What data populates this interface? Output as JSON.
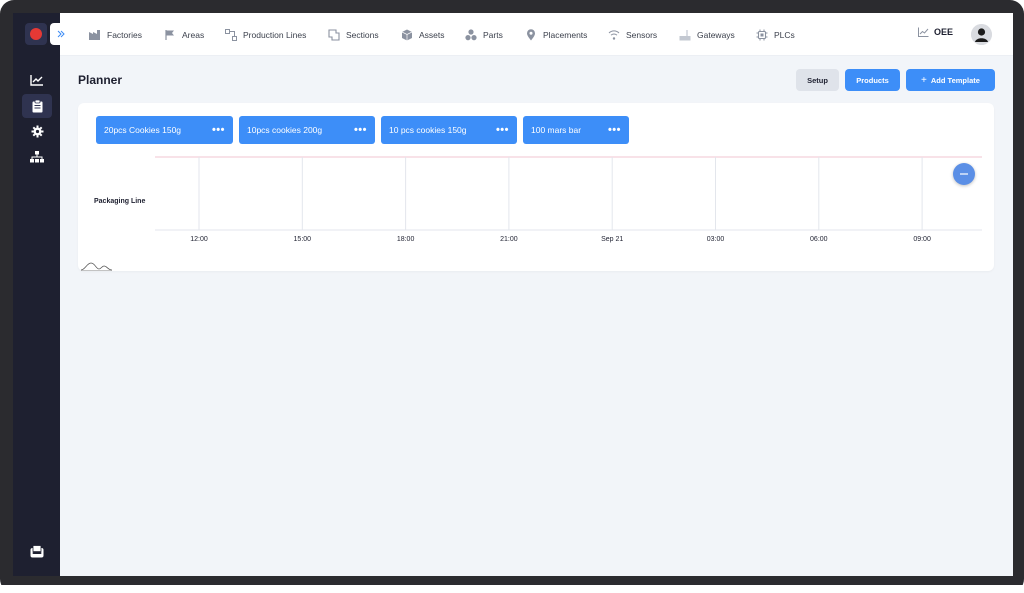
{
  "nav": {
    "items": [
      {
        "label": "Factories",
        "icon": "factory-icon"
      },
      {
        "label": "Areas",
        "icon": "flag-icon"
      },
      {
        "label": "Production Lines",
        "icon": "production-line-icon"
      },
      {
        "label": "Sections",
        "icon": "sections-icon"
      },
      {
        "label": "Assets",
        "icon": "cube-icon"
      },
      {
        "label": "Parts",
        "icon": "parts-icon"
      },
      {
        "label": "Placements",
        "icon": "pin-icon"
      },
      {
        "label": "Sensors",
        "icon": "wifi-icon"
      },
      {
        "label": "Gateways",
        "icon": "gateway-icon"
      },
      {
        "label": "PLCs",
        "icon": "chip-icon"
      }
    ],
    "oee_label": "OEE"
  },
  "sidebar": {
    "items": [
      {
        "name": "analytics",
        "icon": "chart-line-icon"
      },
      {
        "name": "planner",
        "icon": "clipboard-icon",
        "active": true
      },
      {
        "name": "settings",
        "icon": "gear-icon"
      },
      {
        "name": "hierarchy",
        "icon": "sitemap-icon"
      }
    ],
    "bottom_icon": "inbox-icon"
  },
  "page": {
    "title": "Planner",
    "setup_label": "Setup",
    "products_label": "Products",
    "add_template_label": "Add Template"
  },
  "templates": [
    {
      "label": "20pcs Cookies 150g"
    },
    {
      "label": "10pcs cookies 200g"
    },
    {
      "label": "10 pcs cookies 150g"
    },
    {
      "label": "100 mars bar"
    }
  ],
  "timeline": {
    "row_label": "Packaging Line",
    "ticks": [
      "12:00",
      "15:00",
      "18:00",
      "21:00",
      "Sep 21",
      "03:00",
      "06:00",
      "09:00"
    ]
  },
  "colors": {
    "accent": "#3d8ef8",
    "sidebar": "#1e2030",
    "background": "#f2f5f9"
  }
}
